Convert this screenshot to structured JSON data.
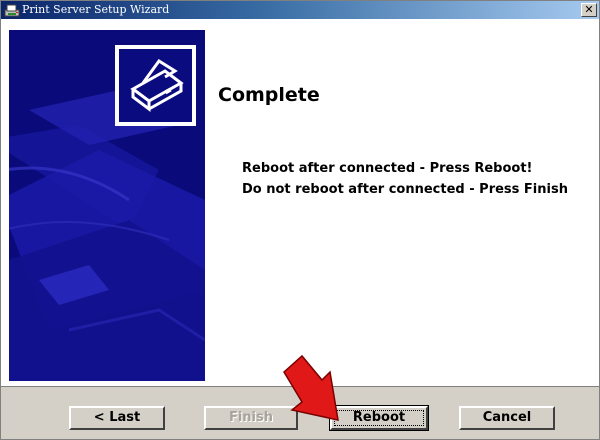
{
  "window": {
    "title": "Print Server Setup Wizard",
    "close_label": "✕"
  },
  "page": {
    "heading": "Complete",
    "message_line1": "Reboot after connected - Press Reboot!",
    "message_line2": "Do not reboot after connected - Press Finish"
  },
  "buttons": {
    "last": "< Last",
    "finish": "Finish",
    "reboot": "Reboot",
    "cancel": "Cancel",
    "finish_enabled": false,
    "reboot_focused": true
  },
  "icons": {
    "title": "printer-icon",
    "close": "close-icon",
    "wizard_logo": "printer-icon",
    "annotation": "red-arrow-icon"
  },
  "colors": {
    "side_panel": "#0a0a7a",
    "button_face": "#d4d0c8",
    "arrow": "#e01818"
  }
}
